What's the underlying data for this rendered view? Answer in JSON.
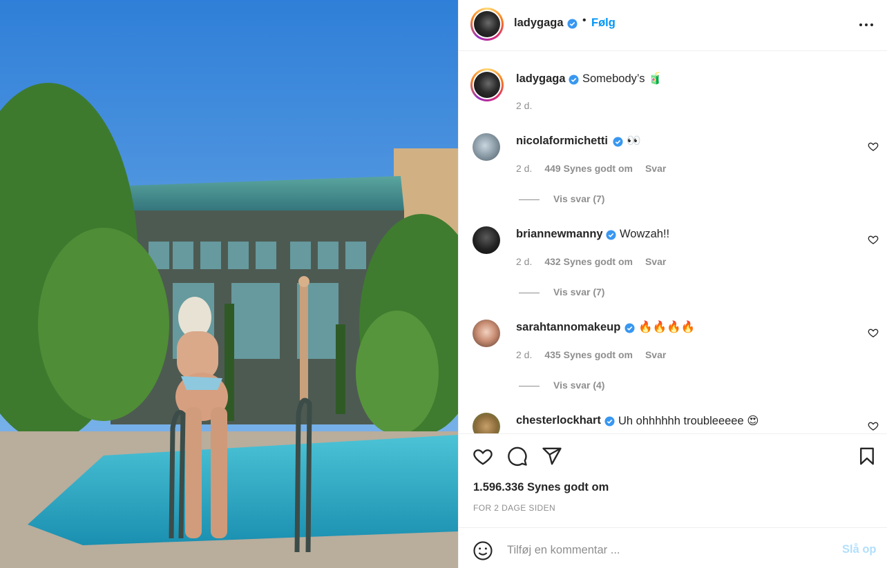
{
  "post": {
    "image_alt": "Photo",
    "author": "ladygaga",
    "follow_label": "Følg",
    "more_icon": "more-horizontal-icon",
    "caption_text": "Somebody’s 🧃",
    "caption_time": "2 d."
  },
  "comments": [
    {
      "user": "nicolaformichetti",
      "text": "👀",
      "time": "2 d.",
      "likes": "449 Synes godt om",
      "reply": "Svar",
      "view_replies": "Vis svar (7)"
    },
    {
      "user": "briannewmanny",
      "text": "Wowzah!!",
      "time": "2 d.",
      "likes": "432 Synes godt om",
      "reply": "Svar",
      "view_replies": "Vis svar (7)"
    },
    {
      "user": "sarahtannomakeup",
      "text": "🔥🔥🔥🔥",
      "time": "2 d.",
      "likes": "435 Synes godt om",
      "reply": "Svar",
      "view_replies": "Vis svar (4)"
    },
    {
      "user": "chesterlockhart",
      "text": "Uh ohhhhhh troubleeeee 😍"
    }
  ],
  "actions": {
    "like_icon": "heart-icon",
    "comment_icon": "comment-icon",
    "share_icon": "paper-plane-icon",
    "save_icon": "bookmark-icon",
    "likes_count": "1.596.336 Synes godt om",
    "date_label": "FOR 2 DAGE SIDEN"
  },
  "add_comment": {
    "placeholder": "Tilføj en kommentar ...",
    "post_label": "Slå op",
    "emoji_icon": "smiley-icon"
  },
  "colors": {
    "accent": "#0095f6",
    "verified": "#3897f0",
    "muted": "#8e8e8e",
    "post_disabled": "#b2dffc"
  }
}
